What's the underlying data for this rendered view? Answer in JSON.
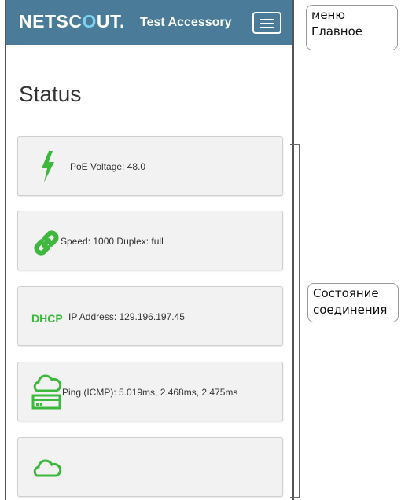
{
  "header": {
    "brand_prefix": "NETSC",
    "brand_o": "O",
    "brand_suffix": "UT.",
    "app_title": "Test Accessory",
    "menu_icon": "hamburger-icon"
  },
  "page": {
    "title": "Status"
  },
  "cards": [
    {
      "icon": "bolt-icon",
      "text": "PoE Voltage: 48.0"
    },
    {
      "icon": "link-icon",
      "text": "Speed: 1000 Duplex: full"
    },
    {
      "icon": "dhcp-label",
      "label": "DHCP",
      "text": "IP Address: 129.196.197.45"
    },
    {
      "icon": "cloud-server-icon",
      "text": "Ping (ICMP): 5.019ms, 2.468ms, 2.475ms"
    },
    {
      "icon": "cloud-icon",
      "text": ""
    }
  ],
  "annotations": {
    "menu_line1": "меню",
    "menu_line2": "Главное",
    "status_line1": "Состояние",
    "status_line2": "соединения"
  },
  "colors": {
    "header_bg": "#4a7b98",
    "accent_green": "#3db83d",
    "logo_o": "#7ad1f2"
  }
}
